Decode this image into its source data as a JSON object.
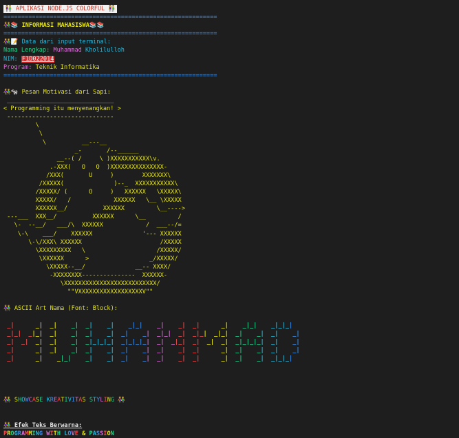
{
  "app_header": "👫 APLIKASI NODE.JS COLORFUL 👫",
  "separator": "============================================================",
  "info_title": "👫📚 INFORMASI MAHASISWA📚📚",
  "input_label": "👫📝 Data dari input terminal:",
  "student": {
    "name_label": "Nama Lengkap:",
    "first_name": "Muhammad",
    "last_name": "Kholilulloh",
    "nim_label": "NIM:",
    "nim": "F1D022014",
    "program_label": "Program:",
    "program": "Teknik Informatika"
  },
  "motivation_label": "👫🐄 Pesan Motivasi dari Sapi:",
  "cow_lines": [
    " ______________________________",
    "< Programming itu menyenangkan! >",
    " ------------------------------",
    "         \\",
    "          \\",
    "           \\          __---__",
    "                    _-       /--______",
    "               __--( /     \\ )XXXXXXXXXXX\\v.",
    "             .-XXX(   O   O  )XXXXXXXXXXXXXXX-",
    "            /XXX(       U     )        XXXXXXX\\",
    "          /XXXXX(              )--_  XXXXXXXXXXX\\",
    "         /XXXXX/ (      O     )   XXXXXX   \\XXXXX\\",
    "         XXXXX/   /            XXXXXX   \\__ \\XXXXX",
    "         XXXXXX__/          XXXXXX         \\__---->",
    " ---___  XXX__/          XXXXXX      \\__         /",
    "   \\-  --__/   ___/\\  XXXXXX            /  ___--/=",
    "    \\-\\    ___/    XXXXXX              '--- XXXXXX",
    "       \\-\\/XXX\\ XXXXXX                      /XXXXX",
    "         \\XXXXXXXXX   \\                    /XXXXX/",
    "          \\XXXXXX      >                 _/XXXXX/",
    "            \\XXXXX--__/              __-- XXXX/",
    "             -XXXXXXXX---------------  XXXXXX-",
    "                \\XXXXXXXXXXXXXXXXXXXXXXXXXX/",
    "                  \"\"VXXXXXXXXXXXXXXXXXXV\"\""
  ],
  "ascii_label_prefix": "👫 ASCII Art Nama (Font: Block):",
  "ascii_art": {
    "lines": [
      " _|      _|  _|    _|  _|    _|    _|_|    _|    _|  _|      _|    _|_|    _|_|_|",
      " _|_|  _|_|  _|    _|  _|    _|  _|    _|  _|_|  _|  _|_|  _|_|  _|    _|  _|    _|",
      " _|  _|  _|  _|    _|  _|_|_|_|  _|_|_|_|  _|  _|_|  _|  _|  _|  _|_|_|_|  _|    _|",
      " _|      _|  _|    _|  _|    _|  _|    _|  _|    _|  _|      _|  _|    _|  _|    _|",
      " _|      _|    _|_|    _|    _|  _|    _|  _|    _|  _|      _|  _|    _|  _|_|_|"
    ],
    "colors": [
      "#f14c4c",
      "#e5e510",
      "#23d18b",
      "#29b8db",
      "#3b8eea",
      "#d670d6"
    ]
  },
  "showcase_title": "👫 SHOWCASE KREATIVITAS STYLING 👫",
  "effect_label": "👫 Efek Teks Berwarna:",
  "rainbow_text": "PROGRAMMING WITH LOVE & PASSION",
  "rainbow_colors": [
    "#f14c4c",
    "#e5e510",
    "#23d18b",
    "#29b8db",
    "#3b8eea",
    "#d670d6"
  ]
}
